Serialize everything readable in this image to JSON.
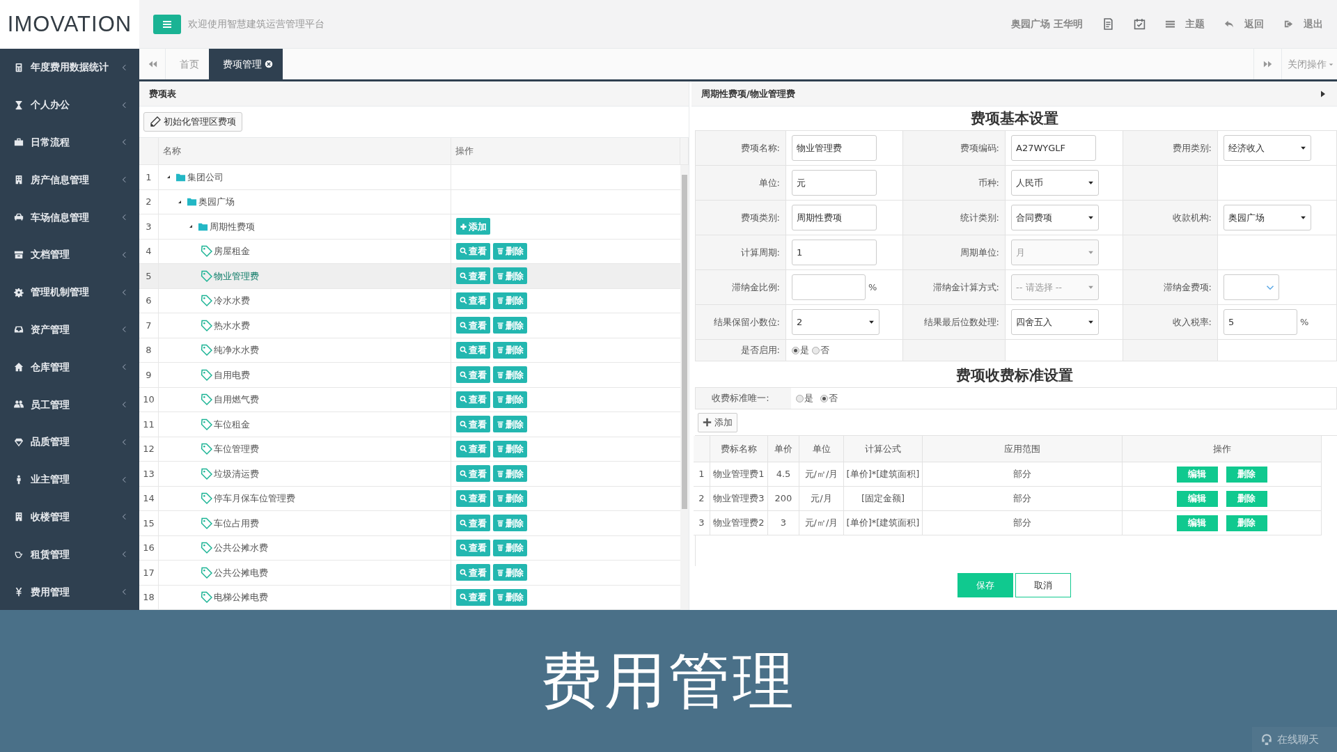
{
  "header": {
    "logo": "IMOVATION",
    "welcome": "欢迎使用智慧建筑运营管理平台",
    "user": "奥园广场 王华明",
    "actions": [
      {
        "kind": "icon"
      },
      {
        "kind": "icon"
      },
      {
        "kind": "labeled",
        "label": "主题"
      },
      {
        "kind": "labeled",
        "label": "返回"
      },
      {
        "kind": "labeled",
        "label": "退出"
      }
    ]
  },
  "sidebar": {
    "items": [
      {
        "label": "年度费用数据统计"
      },
      {
        "label": "个人办公"
      },
      {
        "label": "日常流程"
      },
      {
        "label": "房产信息管理"
      },
      {
        "label": "车场信息管理"
      },
      {
        "label": "文档管理"
      },
      {
        "label": "管理机制管理"
      },
      {
        "label": "资产管理"
      },
      {
        "label": "仓库管理"
      },
      {
        "label": "员工管理"
      },
      {
        "label": "品质管理"
      },
      {
        "label": "业主管理"
      },
      {
        "label": "收楼管理"
      },
      {
        "label": "租赁管理"
      },
      {
        "label": "费用管理"
      }
    ]
  },
  "tabs": [
    {
      "label": "首页",
      "selected": false,
      "closable": false
    },
    {
      "label": "费项管理",
      "selected": true,
      "closable": true
    }
  ],
  "close_menu": "关闭操作",
  "left_panel": {
    "title": "费项表",
    "init_button": "初始化管理区费项",
    "columns": [
      "名称",
      "操作"
    ],
    "tree": [
      {
        "no": "1",
        "label": "集团公司",
        "kind": "folder",
        "expanded": true,
        "selected": false,
        "children": [
          {
            "no": "2",
            "label": "奥园广场",
            "kind": "folder",
            "expanded": true,
            "selected": false,
            "children": [
              {
                "no": "3",
                "label": "周期性费项",
                "kind": "folder",
                "expanded": true,
                "selected": false,
                "actions": [
                  {
                    "kind": "add",
                    "label": "添加"
                  }
                ],
                "children": [
                  {
                    "no": "4",
                    "label": "房屋租金",
                    "kind": "leaf",
                    "selected": false,
                    "actions": [
                      {
                        "kind": "view",
                        "label": "查看"
                      },
                      {
                        "kind": "delete",
                        "label": "删除"
                      }
                    ]
                  },
                  {
                    "no": "5",
                    "label": "物业管理费",
                    "kind": "leaf",
                    "selected": true,
                    "actions": [
                      {
                        "kind": "view",
                        "label": "查看"
                      },
                      {
                        "kind": "delete",
                        "label": "删除"
                      }
                    ]
                  },
                  {
                    "no": "6",
                    "label": "冷水水费",
                    "kind": "leaf",
                    "selected": false,
                    "actions": [
                      {
                        "kind": "view",
                        "label": "查看"
                      },
                      {
                        "kind": "delete",
                        "label": "删除"
                      }
                    ]
                  },
                  {
                    "no": "7",
                    "label": "热水水费",
                    "kind": "leaf",
                    "selected": false,
                    "actions": [
                      {
                        "kind": "view",
                        "label": "查看"
                      },
                      {
                        "kind": "delete",
                        "label": "删除"
                      }
                    ]
                  },
                  {
                    "no": "8",
                    "label": "纯净水水费",
                    "kind": "leaf",
                    "selected": false,
                    "actions": [
                      {
                        "kind": "view",
                        "label": "查看"
                      },
                      {
                        "kind": "delete",
                        "label": "删除"
                      }
                    ]
                  },
                  {
                    "no": "9",
                    "label": "自用电费",
                    "kind": "leaf",
                    "selected": false,
                    "actions": [
                      {
                        "kind": "view",
                        "label": "查看"
                      },
                      {
                        "kind": "delete",
                        "label": "删除"
                      }
                    ]
                  },
                  {
                    "no": "10",
                    "label": "自用燃气费",
                    "kind": "leaf",
                    "selected": false,
                    "actions": [
                      {
                        "kind": "view",
                        "label": "查看"
                      },
                      {
                        "kind": "delete",
                        "label": "删除"
                      }
                    ]
                  },
                  {
                    "no": "11",
                    "label": "车位租金",
                    "kind": "leaf",
                    "selected": false,
                    "actions": [
                      {
                        "kind": "view",
                        "label": "查看"
                      },
                      {
                        "kind": "delete",
                        "label": "删除"
                      }
                    ]
                  },
                  {
                    "no": "12",
                    "label": "车位管理费",
                    "kind": "leaf",
                    "selected": false,
                    "actions": [
                      {
                        "kind": "view",
                        "label": "查看"
                      },
                      {
                        "kind": "delete",
                        "label": "删除"
                      }
                    ]
                  },
                  {
                    "no": "13",
                    "label": "垃圾清运费",
                    "kind": "leaf",
                    "selected": false,
                    "actions": [
                      {
                        "kind": "view",
                        "label": "查看"
                      },
                      {
                        "kind": "delete",
                        "label": "删除"
                      }
                    ]
                  },
                  {
                    "no": "14",
                    "label": "停车月保车位管理费",
                    "kind": "leaf",
                    "selected": false,
                    "actions": [
                      {
                        "kind": "view",
                        "label": "查看"
                      },
                      {
                        "kind": "delete",
                        "label": "删除"
                      }
                    ]
                  },
                  {
                    "no": "15",
                    "label": "车位占用费",
                    "kind": "leaf",
                    "selected": false,
                    "actions": [
                      {
                        "kind": "view",
                        "label": "查看"
                      },
                      {
                        "kind": "delete",
                        "label": "删除"
                      }
                    ]
                  },
                  {
                    "no": "16",
                    "label": "公共公摊水费",
                    "kind": "leaf",
                    "selected": false,
                    "actions": [
                      {
                        "kind": "view",
                        "label": "查看"
                      },
                      {
                        "kind": "delete",
                        "label": "删除"
                      }
                    ]
                  },
                  {
                    "no": "17",
                    "label": "公共公摊电费",
                    "kind": "leaf",
                    "selected": false,
                    "actions": [
                      {
                        "kind": "view",
                        "label": "查看"
                      },
                      {
                        "kind": "delete",
                        "label": "删除"
                      }
                    ]
                  },
                  {
                    "no": "18",
                    "label": "电梯公摊电费",
                    "kind": "leaf",
                    "selected": false,
                    "actions": [
                      {
                        "kind": "view",
                        "label": "查看"
                      },
                      {
                        "kind": "delete",
                        "label": "删除"
                      }
                    ]
                  }
                ]
              }
            ]
          }
        ]
      }
    ]
  },
  "right_panel": {
    "breadcrumb": "周期性费项/物业管理费",
    "basic_title": "费项基本设置",
    "form_rows": [
      [
        {
          "kind": "text",
          "label": "费项名称:",
          "value": "物业管理费"
        },
        {
          "kind": "text",
          "label": "费项编码:",
          "value": "A27WYGLF"
        },
        {
          "kind": "select",
          "label": "费用类别:",
          "value": "经济收入",
          "disabled": false
        }
      ],
      [
        {
          "kind": "text",
          "label": "单位:",
          "value": "元"
        },
        {
          "kind": "select",
          "label": "币种:",
          "value": "人民币",
          "disabled": false
        },
        {
          "kind": "blank"
        }
      ],
      [
        {
          "kind": "text",
          "label": "费项类别:",
          "value": "周期性费项"
        },
        {
          "kind": "select",
          "label": "统计类别:",
          "value": "合同费项",
          "disabled": false
        },
        {
          "kind": "select",
          "label": "收款机构:",
          "value": "奥园广场",
          "disabled": false
        }
      ],
      [
        {
          "kind": "text",
          "label": "计算周期:",
          "value": "1"
        },
        {
          "kind": "select",
          "label": "周期单位:",
          "value": "月",
          "disabled": true
        },
        {
          "kind": "blank"
        }
      ],
      [
        {
          "kind": "text",
          "label": "滞纳金比例:",
          "suffix": "%"
        },
        {
          "kind": "select",
          "label": "滞纳金计算方式:",
          "value": "-- 请选择 --",
          "disabled": true
        },
        {
          "kind": "combo",
          "label": "滞纳金费项:"
        }
      ],
      [
        {
          "kind": "select",
          "label": "结果保留小数位:",
          "value": "2",
          "disabled": false
        },
        {
          "kind": "select",
          "label": "结果最后位数处理:",
          "value": "四舍五入",
          "disabled": false
        },
        {
          "kind": "text",
          "label": "收入税率:",
          "value": "5",
          "suffix": "%"
        }
      ],
      [
        {
          "kind": "radio",
          "label": "是否启用:",
          "options": [
            {
              "label": "是",
              "selected": true
            },
            {
              "label": "否",
              "selected": false
            }
          ]
        },
        {
          "kind": "blank"
        },
        {
          "kind": "blank"
        }
      ]
    ],
    "standard_title": "费项收费标准设置",
    "unique": {
      "label": "收费标准唯一:",
      "options": [
        {
          "label": "是",
          "selected": false
        },
        {
          "label": "否",
          "selected": true
        }
      ]
    },
    "add_button": "添加",
    "columns": [
      "费标名称",
      "单价",
      "单位",
      "计算公式",
      "应用范围",
      "操作"
    ],
    "rows": [
      {
        "no": "1",
        "name": "物业管理费1",
        "price": "4.5",
        "unit": "元/㎡/月",
        "formula": "[单价]*[建筑面积]",
        "scope": "部分",
        "actions": [
          "编辑",
          "删除"
        ]
      },
      {
        "no": "2",
        "name": "物业管理费3",
        "price": "200",
        "unit": "元/月",
        "formula": "[固定金额]",
        "scope": "部分",
        "actions": [
          "编辑",
          "删除"
        ]
      },
      {
        "no": "3",
        "name": "物业管理费2",
        "price": "3",
        "unit": "元/㎡/月",
        "formula": "[单价]*[建筑面积]",
        "scope": "部分",
        "actions": [
          "编辑",
          "删除"
        ]
      }
    ],
    "save": "保存",
    "cancel": "取消"
  },
  "caption": "费用管理",
  "chat": "在线聊天"
}
